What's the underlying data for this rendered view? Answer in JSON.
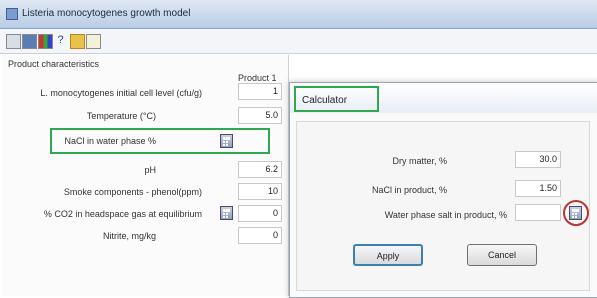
{
  "window": {
    "title": "Listeria monocytogenes growth model"
  },
  "toolbar": {
    "icons": [
      "open-icon",
      "save-icon",
      "palette-icon",
      "help-icon",
      "folder-icon",
      "document-icon"
    ]
  },
  "product_panel": {
    "section_label": "Product characteristics",
    "column_header": "Product 1",
    "rows": [
      {
        "label": "L. monocytogenes initial cell level (cfu/g)",
        "value": "1"
      },
      {
        "label": "Temperature (°C)",
        "value": "5.0"
      },
      {
        "label": "NaCl in water phase %",
        "value": ""
      },
      {
        "label": "pH",
        "value": "6.2"
      },
      {
        "label": "Smoke components - phenol(ppm)",
        "value": "10"
      },
      {
        "label": "% CO2 in headspace gas at equilibrium",
        "value": "0"
      },
      {
        "label": "Nitrite, mg/kg",
        "value": "0"
      }
    ]
  },
  "calculator": {
    "title": "Calculator",
    "dry_matter": {
      "label": "Dry matter, %",
      "value": "30.0"
    },
    "nacl_product": {
      "label": "NaCl in product, %",
      "value": "1.50"
    },
    "water_phase_salt": {
      "label": "Water phase salt in product, %",
      "value": ""
    },
    "apply_label": "Apply",
    "cancel_label": "Cancel"
  },
  "highlight_colors": {
    "green": "#2fa84f",
    "red": "#b33333"
  }
}
